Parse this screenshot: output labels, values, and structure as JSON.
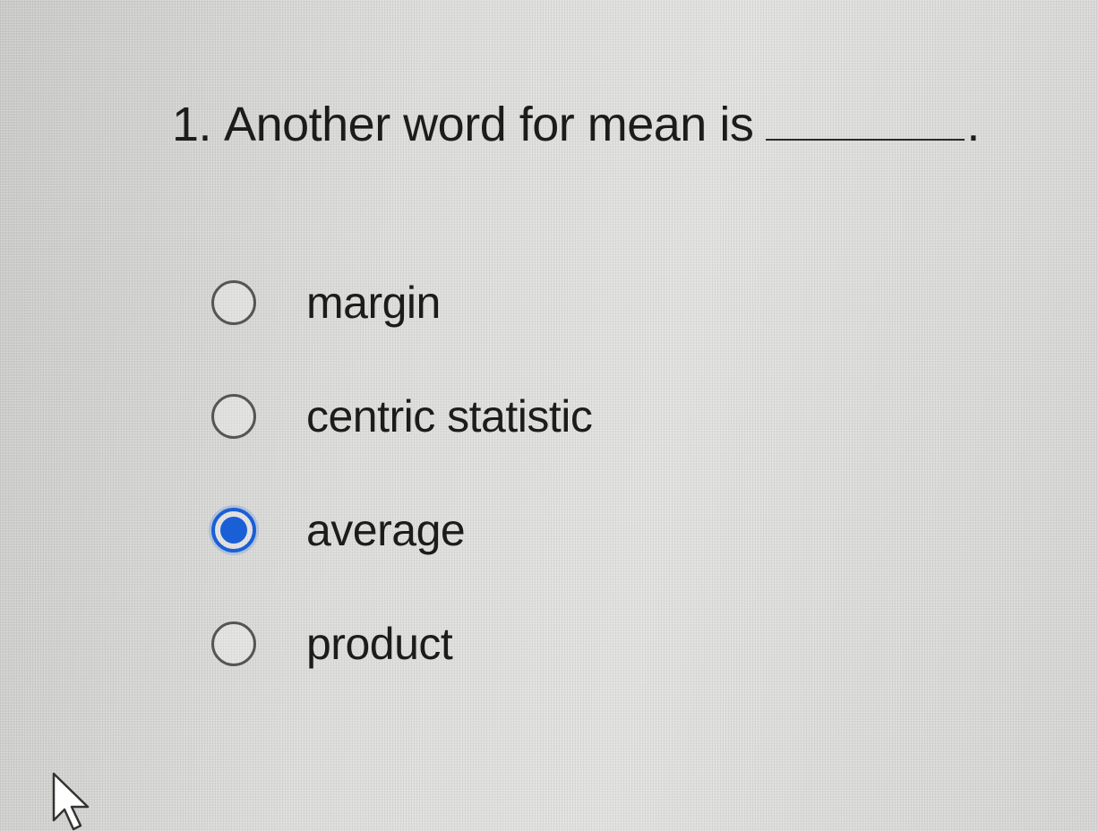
{
  "question": {
    "number": "1.",
    "text": "Another word for mean is",
    "blank_end": "."
  },
  "options": [
    {
      "label": "margin",
      "selected": false
    },
    {
      "label": "centric statistic",
      "selected": false
    },
    {
      "label": "average",
      "selected": true
    },
    {
      "label": "product",
      "selected": false
    }
  ],
  "selected_option": "average",
  "colors": {
    "accent": "#1a5fd6",
    "text": "#1c1c1c",
    "radio_border": "#555555"
  },
  "icons": {
    "cursor": "arrow-cursor-icon"
  }
}
